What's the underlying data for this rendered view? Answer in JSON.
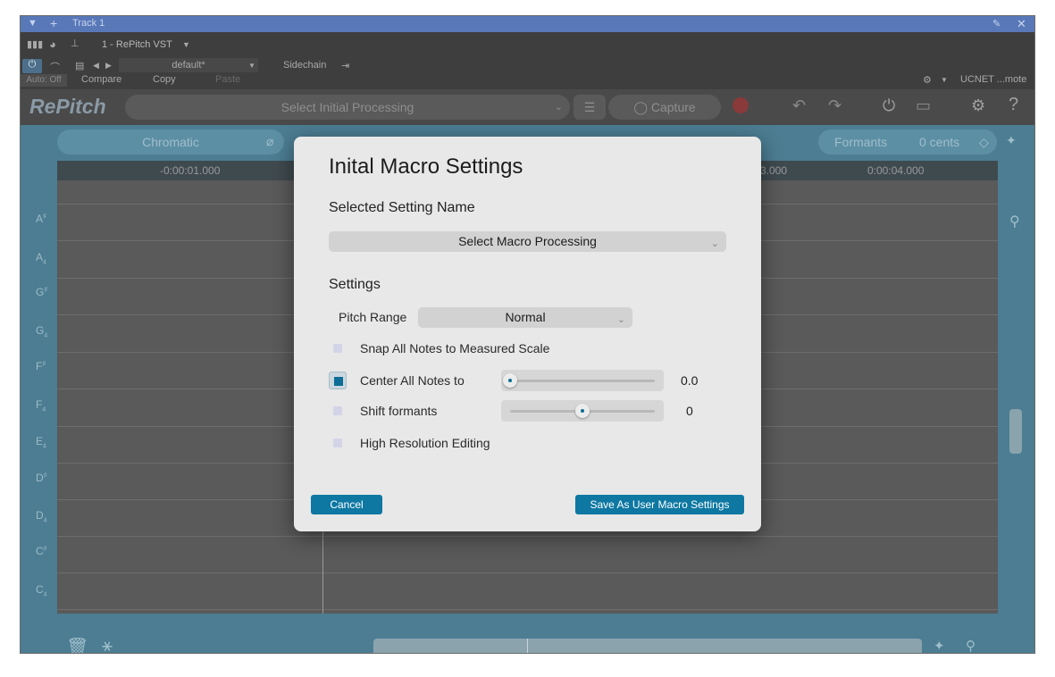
{
  "window": {
    "track_title": "Track 1",
    "host": {
      "plugin_slot": "1 - RePitch VST",
      "preset": "default*",
      "sidechain": "Sidechain",
      "auto": "Auto: Off",
      "compare": "Compare",
      "copy": "Copy",
      "paste": "Paste",
      "remote": "UCNET ...mote"
    }
  },
  "plugin": {
    "logo": "RePitch",
    "initial_processing": "Select Initial Processing",
    "capture": "Capture"
  },
  "editor": {
    "scale": "Chromatic",
    "formants_label": "Formants",
    "cents": "0 cents",
    "ruler": {
      "left": "-0:00:01.000",
      "right_partial": "3.000",
      "right": "0:00:04.000"
    },
    "notes": [
      {
        "name": "A",
        "mark": "♯"
      },
      {
        "name": "A",
        "mark": "4"
      },
      {
        "name": "G",
        "mark": "♯"
      },
      {
        "name": "G",
        "mark": "4"
      },
      {
        "name": "F",
        "mark": "♯"
      },
      {
        "name": "F",
        "mark": "4"
      },
      {
        "name": "E",
        "mark": "4"
      },
      {
        "name": "D",
        "mark": "♯"
      },
      {
        "name": "D",
        "mark": "4"
      },
      {
        "name": "C",
        "mark": "♯"
      },
      {
        "name": "C",
        "mark": "4"
      }
    ]
  },
  "dialog": {
    "title": "Inital Macro Settings",
    "selected_setting_label": "Selected Setting Name",
    "macro_select": "Select Macro Processing",
    "settings_label": "Settings",
    "pitch_range_label": "Pitch Range",
    "pitch_range_value": "Normal",
    "snap_label": "Snap All Notes to Measured Scale",
    "center_label": "Center All Notes to",
    "center_value": "0.0",
    "center_level": 0.0,
    "shift_label": "Shift formants",
    "shift_value": "0",
    "shift_level": 0.5,
    "high_res_label": "High Resolution Editing",
    "cancel": "Cancel",
    "save": "Save As User Macro Settings"
  }
}
